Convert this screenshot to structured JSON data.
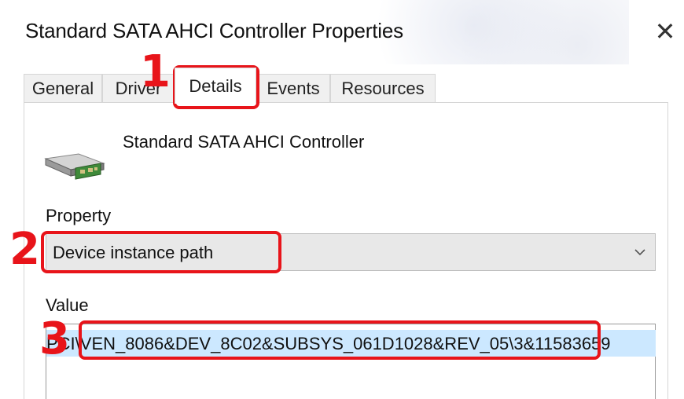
{
  "window": {
    "title": "Standard SATA AHCI Controller Properties",
    "close_icon": "close-icon"
  },
  "tabs": [
    {
      "label": "General"
    },
    {
      "label": "Driver"
    },
    {
      "label": "Details",
      "active": true
    },
    {
      "label": "Events"
    },
    {
      "label": "Resources"
    }
  ],
  "device": {
    "icon": "storage-controller-icon",
    "name": "Standard SATA AHCI Controller"
  },
  "property": {
    "label": "Property",
    "selected": "Device instance path",
    "chevron_icon": "chevron-down-icon"
  },
  "value": {
    "label": "Value",
    "items": [
      "PCI\\VEN_8086&DEV_8C02&SUBSYS_061D1028&REV_05\\3&11583659"
    ]
  },
  "annotations": {
    "color": "#e8141a",
    "steps": [
      "1",
      "2",
      "3"
    ]
  }
}
